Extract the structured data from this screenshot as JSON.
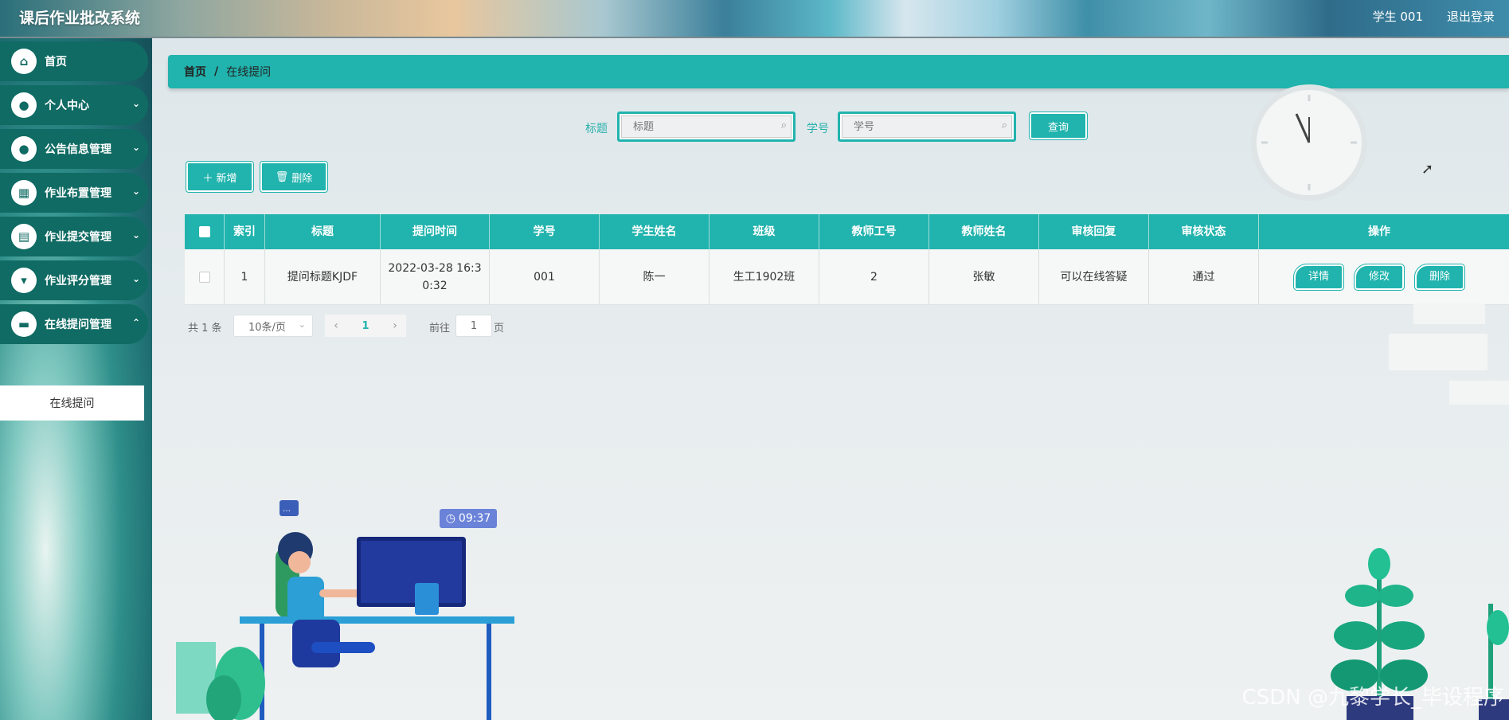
{
  "app": {
    "title": "课后作业批改系统"
  },
  "header": {
    "user": "学生 001",
    "logout": "退出登录"
  },
  "sidebar": {
    "items": [
      {
        "label": "首页",
        "icon": "home-icon"
      },
      {
        "label": "个人中心",
        "icon": "user-icon"
      },
      {
        "label": "公告信息管理",
        "icon": "user-icon"
      },
      {
        "label": "作业布置管理",
        "icon": "grid-icon"
      },
      {
        "label": "作业提交管理",
        "icon": "clipboard-icon"
      },
      {
        "label": "作业评分管理",
        "icon": "stamp-icon"
      },
      {
        "label": "在线提问管理",
        "icon": "briefcase-icon"
      }
    ],
    "submenu": {
      "label": "在线提问"
    }
  },
  "breadcrumb": {
    "home": "首页",
    "separator": "/",
    "current": "在线提问"
  },
  "search": {
    "title_label": "标题",
    "title_placeholder": "标题",
    "student_label": "学号",
    "student_placeholder": "学号",
    "query_button": "查询"
  },
  "toolbar": {
    "add": "新增",
    "delete": "删除"
  },
  "table": {
    "headers": [
      "索引",
      "标题",
      "提问时间",
      "学号",
      "学生姓名",
      "班级",
      "教师工号",
      "教师姓名",
      "审核回复",
      "审核状态",
      "操作"
    ],
    "rows": [
      {
        "index": "1",
        "title": "提问标题KJDF",
        "time": "2022-03-28 16:30:32",
        "student_id": "001",
        "student_name": "陈一",
        "class": "生工1902班",
        "teacher_id": "2",
        "teacher_name": "张敏",
        "reply": "可以在线答疑",
        "status": "通过",
        "actions": [
          "详情",
          "修改",
          "删除"
        ]
      }
    ]
  },
  "pagination": {
    "total": "共 1 条",
    "page_size": "10条/页",
    "current_page": "1",
    "goto_prefix": "前往",
    "goto_value": "1",
    "goto_suffix": "页"
  },
  "decor": {
    "illustration_time": "09:37",
    "watermark": "CSDN @九黎学长_毕设程序"
  },
  "colors": {
    "accent": "#21b3ad",
    "sidebar_item": "#0f6b63"
  }
}
